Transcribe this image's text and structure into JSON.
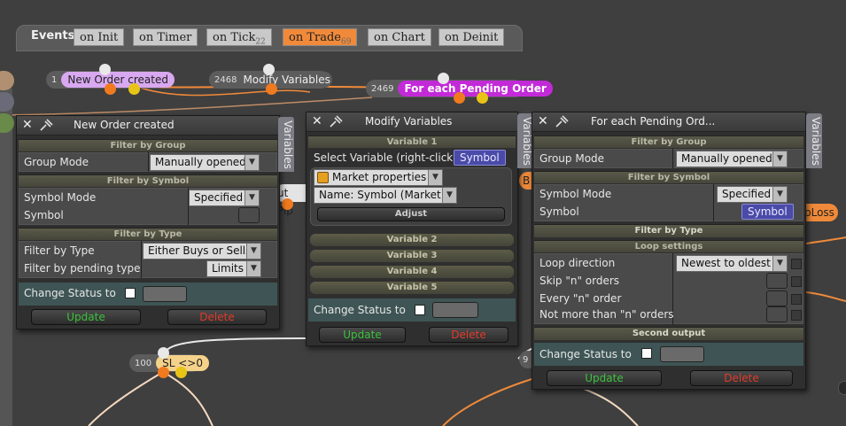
{
  "events_bar": {
    "title": "Events",
    "tabs": [
      {
        "label": "on Init",
        "count": ""
      },
      {
        "label": "on Timer",
        "count": ""
      },
      {
        "label": "on Tick",
        "count": "22"
      },
      {
        "label": "on Trade",
        "count": "69"
      },
      {
        "label": "on Chart",
        "count": ""
      },
      {
        "label": "on Deinit",
        "count": ""
      }
    ],
    "active_tab": "on Trade"
  },
  "nodes": [
    {
      "num": "1",
      "label": "New Order created",
      "color": "#d8a8f0"
    },
    {
      "num": "2468",
      "label": "Modify Variables",
      "color": "#5c5c5c"
    },
    {
      "num": "2469",
      "label": "For each Pending Order",
      "color": "#c22ad8"
    },
    {
      "num": "100",
      "label": "SL <>0",
      "color": "#f4d28a"
    },
    {
      "num": "9",
      "label": "",
      "color": "#5c5c5c"
    }
  ],
  "partial_labels": {
    "out_pip": "ut Pip",
    "b_node": "B",
    "loss_node": "pLoss"
  },
  "panel_new_order": {
    "title": "New Order created",
    "side_tab": "Variables",
    "filter_group_header": "Filter by Group",
    "group_mode_label": "Group Mode",
    "group_mode_value": "Manually opened",
    "filter_symbol_header": "Filter by Symbol",
    "symbol_mode_label": "Symbol Mode",
    "symbol_mode_value": "Specified",
    "symbol_label": "Symbol",
    "filter_type_header": "Filter by Type",
    "filter_type_label": "Filter by Type",
    "filter_type_value": "Either Buys or Sells",
    "pending_type_label": "Filter by pending type",
    "pending_type_value": "Limits",
    "change_status_label": "Change Status to",
    "update_label": "Update",
    "delete_label": "Delete"
  },
  "panel_modify": {
    "title": "Modify Variables",
    "side_tab": "Variables",
    "variable1_header": "Variable 1",
    "select_variable_label": "Select Variable (right-click)",
    "select_variable_value": "Symbol",
    "source_value": "Market properties",
    "name_value": "Name: Symbol (Market)",
    "adjust_label": "Adjust",
    "variable2": "Variable 2",
    "variable3": "Variable 3",
    "variable4": "Variable 4",
    "variable5": "Variable 5",
    "change_status_label": "Change Status to",
    "update_label": "Update",
    "delete_label": "Delete"
  },
  "panel_pending": {
    "title": "For each Pending Ord...",
    "side_tab": "Variables",
    "filter_group_header": "Filter by Group",
    "group_mode_label": "Group Mode",
    "group_mode_value": "Manually opened",
    "filter_symbol_header": "Filter by Symbol",
    "symbol_mode_label": "Symbol Mode",
    "symbol_mode_value": "Specified",
    "symbol_label": "Symbol",
    "symbol_value": "Symbol",
    "filter_type_header": "Filter by Type",
    "loop_settings_header": "Loop settings",
    "loop_direction_label": "Loop direction",
    "loop_direction_value": "Newest to oldest",
    "skip_label": "Skip \"n\" orders",
    "every_label": "Every \"n\" order",
    "not_more_label": "Not more than \"n\" orders",
    "second_output_header": "Second output",
    "change_status_label": "Change Status to",
    "update_label": "Update",
    "delete_label": "Delete"
  },
  "colors": {
    "accent_orange": "#f08a3a",
    "update_green": "#3cc23c",
    "delete_red": "#e23a2a",
    "symbol_blue": "#4a4aa8"
  }
}
